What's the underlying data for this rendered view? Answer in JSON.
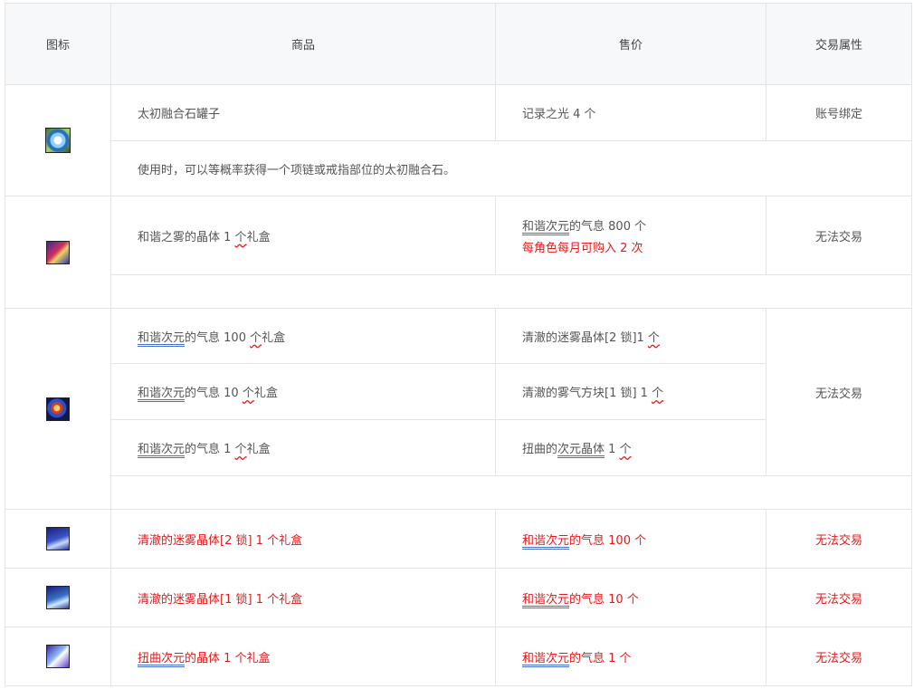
{
  "headers": {
    "icon": "图标",
    "product": "商品",
    "price": "售价",
    "trade": "交易属性"
  },
  "rows": {
    "r1": {
      "icon": "star-crystal-jar-icon",
      "product": "太初融合石罐子",
      "price": "记录之光 4 个",
      "trade": "账号绑定",
      "desc": "使用时，可以等概率获得一个项链或戒指部位的太初融合石。"
    },
    "r2": {
      "icon": "harmony-crystal-box-icon",
      "product_a": "和谐之雾的晶体 1 ",
      "product_b": "个",
      "product_c": "礼盒",
      "price_a": "和谐次元",
      "price_b": "的气息 800 个",
      "price_note": "每角色每月可购入 2 次",
      "trade": "无法交易"
    },
    "r3": {
      "icon": "harmony-breath-orb-icon",
      "trade": "无法交易",
      "subs": [
        {
          "product_a": "和谐次元",
          "product_b": "的气息 100 ",
          "product_c": "个",
          "product_d": "礼盒",
          "price_a": "清澈的迷雾晶体[2 锁]1 ",
          "price_b": "个"
        },
        {
          "product_a": "和谐次元",
          "product_b": "的气息 10 ",
          "product_c": "个",
          "product_d": "礼盒",
          "price_a": "清澈的雾气方块[1 锁] 1 ",
          "price_b": "个"
        },
        {
          "product_a": "和谐次元",
          "product_b": "的气息 1 ",
          "product_c": "个",
          "product_d": "礼盒",
          "price_a": "扭曲的",
          "price_b": "次元晶体",
          "price_c": " 1 ",
          "price_d": "个"
        }
      ]
    },
    "r4": {
      "icon": "lock-2-crystal-icon",
      "product": "清澈的迷雾晶体[2 锁] 1 个礼盒",
      "price_a": "和谐次元",
      "price_b": "的气息 100 个",
      "trade": "无法交易"
    },
    "r5": {
      "icon": "lock-1-block-icon",
      "product": "清澈的迷雾晶体[1 锁] 1 个礼盒",
      "price_a": "和谐次元",
      "price_b": "的气息 10 个",
      "trade": "无法交易"
    },
    "r6": {
      "icon": "twisted-cube-icon",
      "product_a": "扭曲次元",
      "product_b": "的晶体 1 个礼盒",
      "price_a": "和谐次元",
      "price_b": "的气息 1 个",
      "trade": "无法交易"
    }
  },
  "colors": {
    "accent_red": "#e21a1a",
    "underline_blue": "#4a72c4",
    "header_bg": "#f7f8fa",
    "border": "#e1e5ea"
  }
}
